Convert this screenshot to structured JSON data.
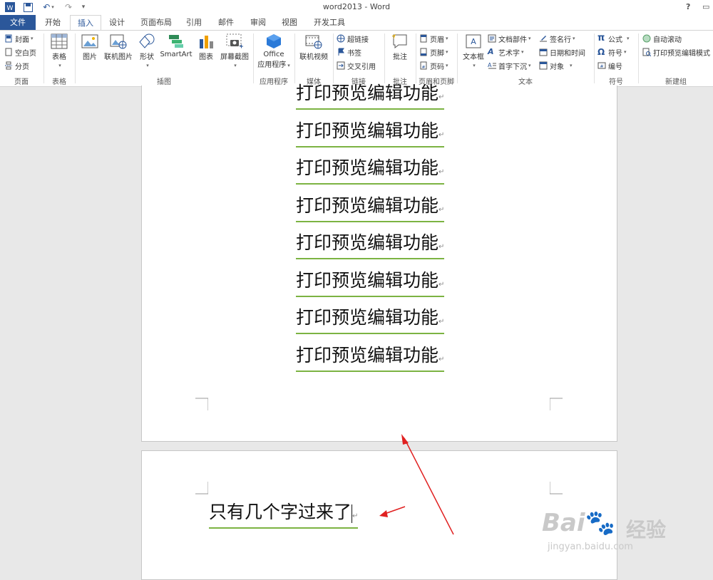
{
  "window": {
    "title": "word2013 - Word",
    "help": "?"
  },
  "tabs": [
    "文件",
    "开始",
    "插入",
    "设计",
    "页面布局",
    "引用",
    "邮件",
    "审阅",
    "视图",
    "开发工具"
  ],
  "ribbon": {
    "pages": {
      "items": [
        "封面",
        "空白页",
        "分页"
      ],
      "label": "页面"
    },
    "tables": {
      "item": "表格",
      "label": "表格"
    },
    "illustrations": {
      "items": [
        "图片",
        "联机图片",
        "形状",
        "SmartArt",
        "图表",
        "屏幕截图"
      ],
      "label": "插图"
    },
    "apps": {
      "item_line1": "Office",
      "item_line2": "应用程序",
      "label": "应用程序"
    },
    "media": {
      "item": "联机视频",
      "label": "媒体"
    },
    "links": {
      "items": [
        "超链接",
        "书签",
        "交叉引用"
      ],
      "label": "链接"
    },
    "comments": {
      "item": "批注",
      "label": "批注"
    },
    "header_footer": {
      "items": [
        "页眉",
        "页脚",
        "页码"
      ],
      "label": "页眉和页脚"
    },
    "text": {
      "textbox": "文本框",
      "col1": [
        "文档部件",
        "艺术字",
        "首字下沉"
      ],
      "col2": [
        "签名行",
        "日期和时间",
        "对象"
      ],
      "label": "文本"
    },
    "symbols": {
      "items": [
        "公式",
        "符号",
        "编号"
      ],
      "label": "符号"
    },
    "newgroup": {
      "items": [
        "自动滚动",
        "打印预览编辑模式"
      ],
      "label": "新建组"
    }
  },
  "document": {
    "page1_lines": [
      "打印预览编辑功能",
      "打印预览编辑功能",
      "打印预览编辑功能",
      "打印预览编辑功能",
      "打印预览编辑功能",
      "打印预览编辑功能",
      "打印预览编辑功能",
      "打印预览编辑功能"
    ],
    "page2_line": "只有几个字过来了"
  },
  "watermark": {
    "brand": "Bai",
    "brand2": "经验",
    "url": "jingyan.baidu.com"
  },
  "colors": {
    "accent": "#2b579a",
    "underline": "#7cb342",
    "arrow": "#e02020"
  }
}
